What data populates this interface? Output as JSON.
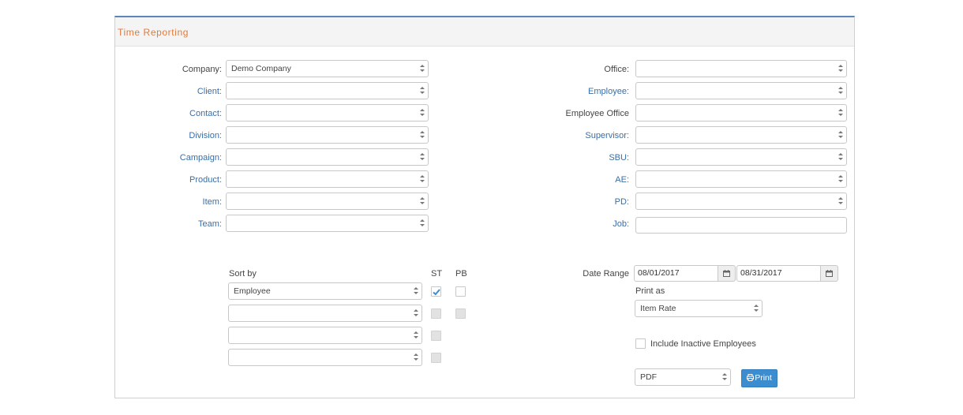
{
  "panel": {
    "title": "Time Reporting"
  },
  "left_fields": [
    {
      "label": "Company:",
      "value": "Demo Company"
    },
    {
      "label": "Client:",
      "value": ""
    },
    {
      "label": "Contact:",
      "value": ""
    },
    {
      "label": "Division:",
      "value": ""
    },
    {
      "label": "Campaign:",
      "value": ""
    },
    {
      "label": "Product:",
      "value": ""
    },
    {
      "label": "Item:",
      "value": ""
    },
    {
      "label": "Team:",
      "value": ""
    }
  ],
  "right_fields": [
    {
      "label": "Office:",
      "value": ""
    },
    {
      "label": "Employee:",
      "value": ""
    },
    {
      "label": "Employee Office",
      "value": ""
    },
    {
      "label": "Supervisor:",
      "value": ""
    },
    {
      "label": "SBU:",
      "value": ""
    },
    {
      "label": "AE:",
      "value": ""
    },
    {
      "label": "PD:",
      "value": ""
    },
    {
      "label": "Job:",
      "value": ""
    }
  ],
  "sort": {
    "label": "Sort by",
    "st_label": "ST",
    "pb_label": "PB",
    "rows": [
      {
        "value": "Employee",
        "st_checked": true
      },
      {
        "value": ""
      },
      {
        "value": ""
      },
      {
        "value": ""
      }
    ]
  },
  "date_range": {
    "label": "Date Range",
    "start": "08/01/2017",
    "end": "08/31/2017"
  },
  "print_as": {
    "label": "Print as",
    "value": "Item Rate"
  },
  "include_inactive": {
    "label": "Include Inactive Employees",
    "checked": false
  },
  "output_format": {
    "value": "PDF"
  },
  "print_button": {
    "label": "Print",
    "icon": "print-icon"
  },
  "colors": {
    "link": "#3a6ea5",
    "title": "#e07a3c",
    "accent": "#3c8dcf",
    "panel_top": "#5a87b7"
  }
}
